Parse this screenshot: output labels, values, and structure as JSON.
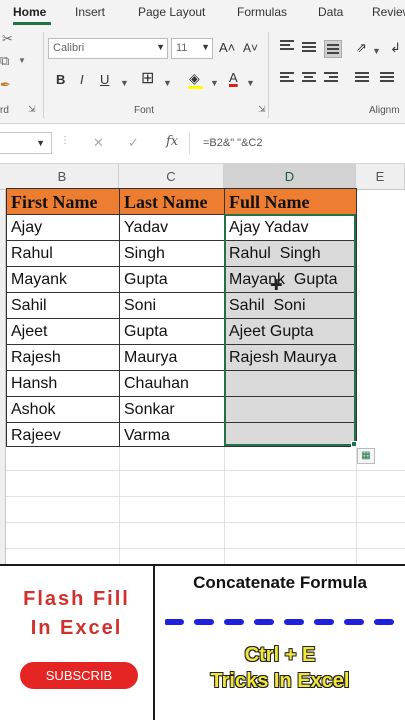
{
  "ribbon": {
    "tabs": [
      "Home",
      "Insert",
      "Page Layout",
      "Formulas",
      "Data",
      "Review"
    ],
    "font_name": "Calibri",
    "font_size": "11",
    "grow_font": "A˄",
    "shrink_font": "A˅",
    "bold": "B",
    "italic": "I",
    "underline": "U",
    "font_color_letter": "A",
    "clipboard_label": "rd",
    "font_group_label": "Font",
    "alignment_group_label": "Alignm",
    "font_color_hex": "#e01b1b",
    "fill_color_hex": "#ffff00"
  },
  "formula_bar": {
    "cancel": "✕",
    "enter": "✓",
    "fx": "fx",
    "formula": "=B2&\" \"&C2"
  },
  "sheet": {
    "columns": [
      "B",
      "C",
      "D",
      "E"
    ],
    "selected_column": "D",
    "headers": [
      "First Name",
      "Last Name",
      "Full Name"
    ],
    "rows": [
      [
        "Ajay",
        "Yadav",
        "Ajay Yadav"
      ],
      [
        "Rahul",
        "Singh",
        "Rahul  Singh"
      ],
      [
        "Mayank",
        "Gupta",
        "Mayank  Gupta"
      ],
      [
        "Sahil",
        "Soni",
        "Sahil  Soni"
      ],
      [
        "Ajeet",
        "Gupta",
        "Ajeet Gupta"
      ],
      [
        "Rajesh",
        "Maurya",
        "Rajesh Maurya"
      ],
      [
        "Hansh",
        "Chauhan",
        ""
      ],
      [
        "Ashok",
        "Sonkar",
        ""
      ],
      [
        "Rajeev",
        "Varma",
        ""
      ]
    ],
    "header_fill_hex": "#ed7d31",
    "selection_hex": "#217346"
  },
  "banner": {
    "title_line1": "Flash Fill",
    "title_line2": "In Excel",
    "subscribe": "SUBSCRIB",
    "concat": "Concatenate Formula",
    "shortcut": "Ctrl + E",
    "tricks": "Tricks In Excel",
    "accent_hex": "#d0312d",
    "yellow_hex": "#f2e63a",
    "dash_hex": "#1f1fe0"
  }
}
